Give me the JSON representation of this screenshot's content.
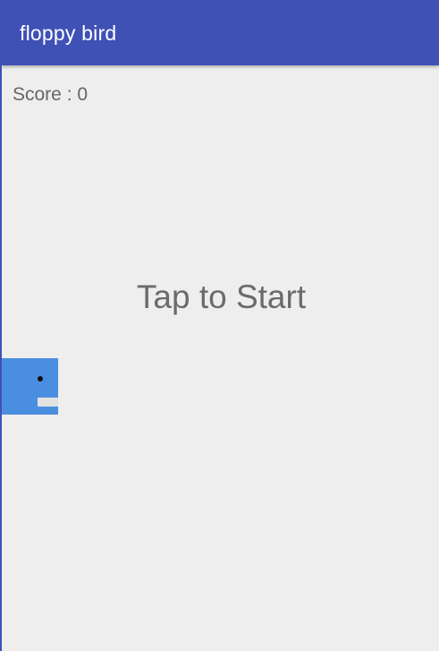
{
  "app_bar": {
    "title": "floppy bird",
    "color": "#3f51b5"
  },
  "hud": {
    "score_text": "Score : 0"
  },
  "overlay": {
    "prompt": "Tap to Start"
  },
  "bird": {
    "color": "#4a8fdf",
    "eye_color": "#111111",
    "beak_color": "#e2e2e2"
  },
  "background_color": "#eeeeee"
}
